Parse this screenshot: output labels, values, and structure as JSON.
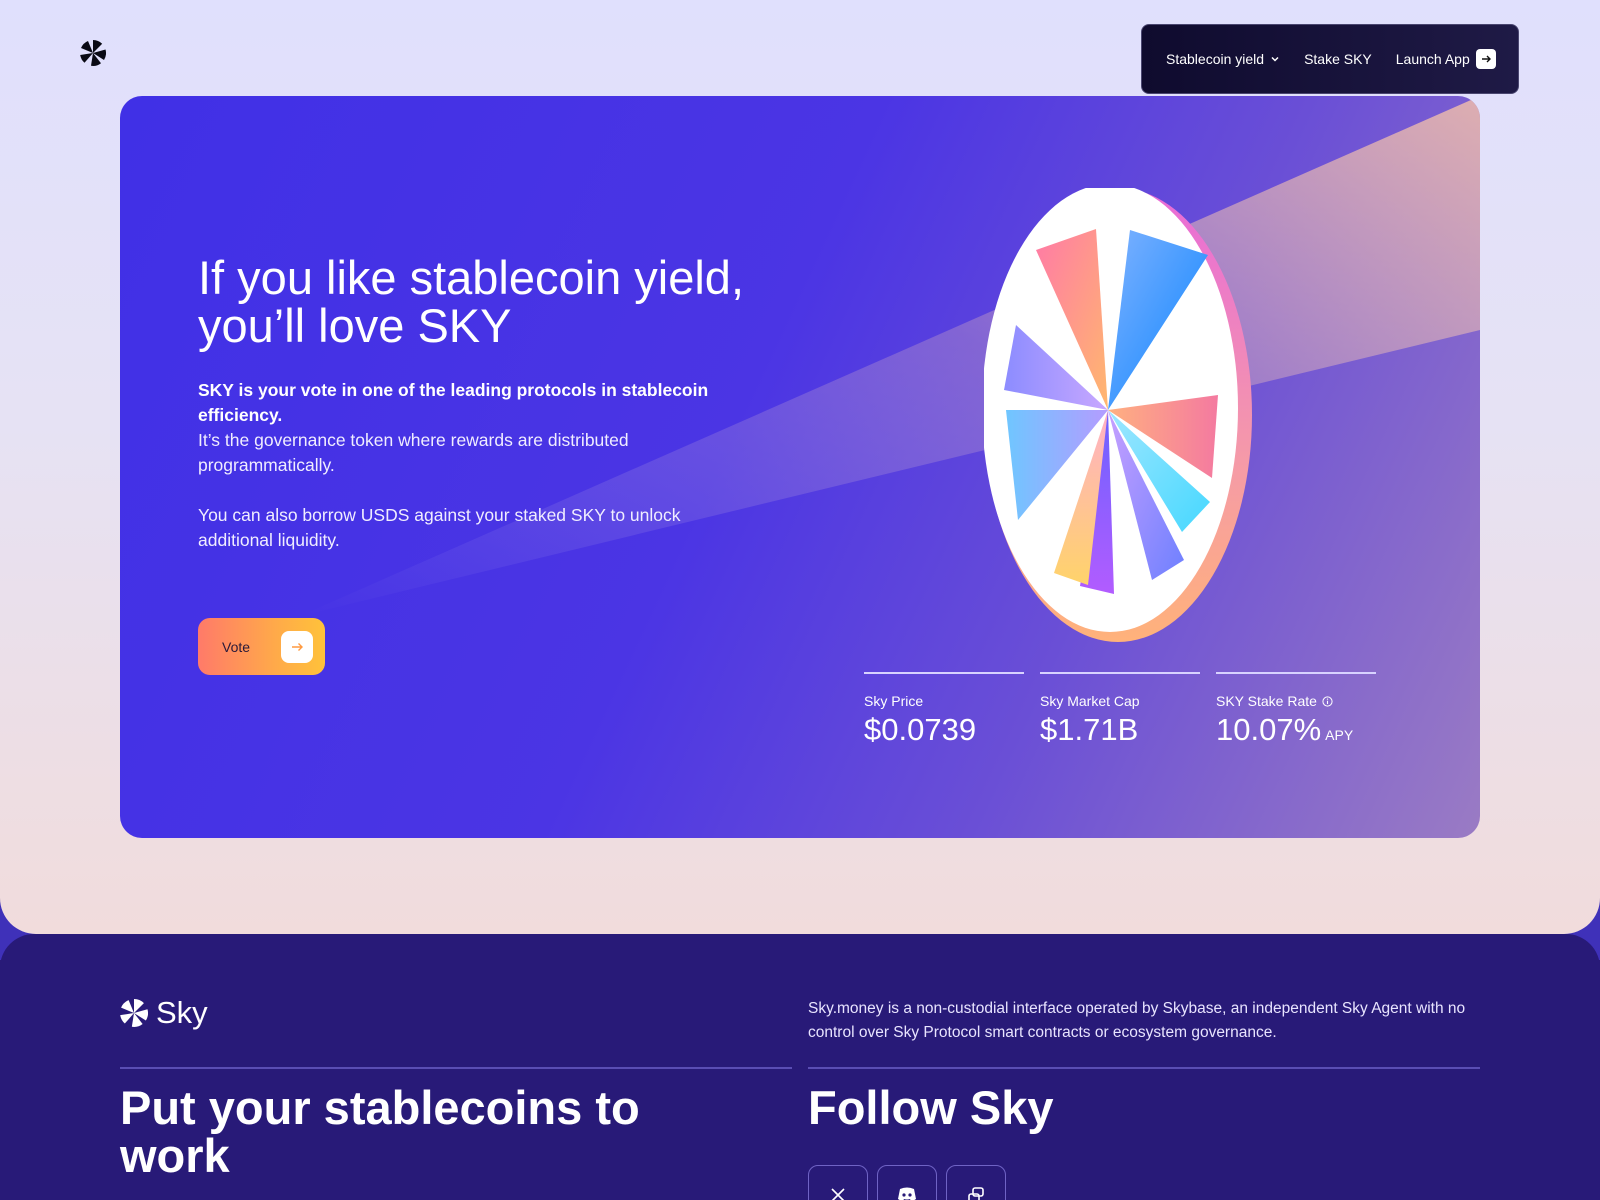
{
  "nav": {
    "stablecoin_yield": "Stablecoin yield",
    "stake_sky": "Stake SKY",
    "launch_app": "Launch App"
  },
  "hero": {
    "title": "If you like stablecoin yield, you’ll love SKY",
    "lead": "SKY is your vote in one of the leading protocols in stablecoin efficiency.",
    "paragraph1": "It’s the governance token where rewards are distributed programmatically.",
    "paragraph2": "You can also borrow USDS against your staked SKY to unlock additional liquidity.",
    "vote_label": "Vote"
  },
  "stats": [
    {
      "label": "Sky Price",
      "value": "$0.0739",
      "unit": ""
    },
    {
      "label": "Sky Market Cap",
      "value": "$1.71B",
      "unit": ""
    },
    {
      "label": "SKY Stake Rate",
      "value": "10.07%",
      "unit": "APY"
    }
  ],
  "footer": {
    "brand": "Sky",
    "disclaimer": "Sky.money is a non-custodial interface operated by Skybase, an independent Sky Agent with no control over Sky Protocol smart contracts or ecosystem governance.",
    "left_heading": "Put your stablecoins to work",
    "right_heading": "Follow Sky",
    "social_icons": [
      "x-icon",
      "discord-icon",
      "link-icon"
    ]
  },
  "colors": {
    "hero_start": "#4030e6",
    "vote_gradient_start": "#ff7a69",
    "vote_gradient_end": "#ffc23a",
    "footer_bg": "#281a78"
  }
}
